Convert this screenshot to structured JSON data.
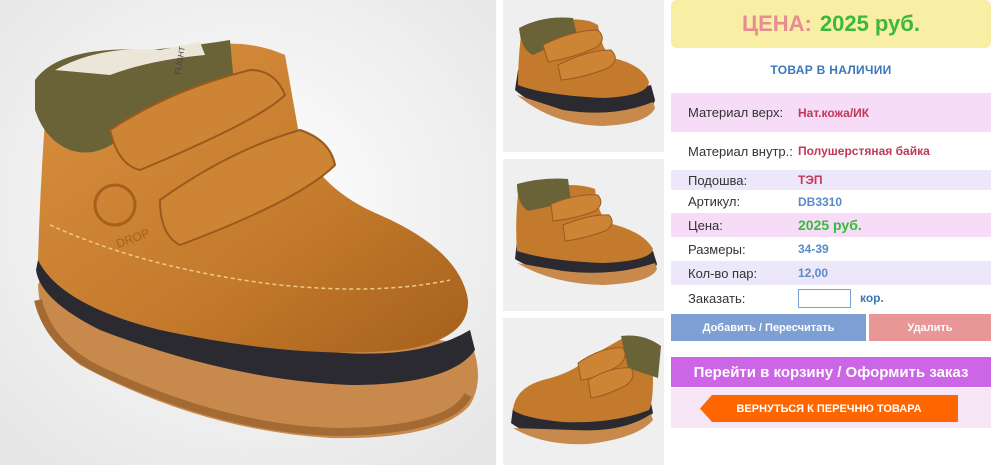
{
  "price_header": {
    "label": "ЦЕНА:",
    "value": "2025 руб."
  },
  "availability": "ТОВАР В НАЛИЧИИ",
  "specs": {
    "material_top": {
      "label": "Материал верх:",
      "value": "Нат.кожа/ИК"
    },
    "material_inner": {
      "label": "Материал внутр.:",
      "value": "Полушерстяная байка"
    },
    "sole": {
      "label": "Подошва:",
      "value": "ТЭП"
    },
    "article": {
      "label": "Артикул:",
      "value": "DB3310"
    },
    "price": {
      "label": "Цена:",
      "value": "2025 руб."
    },
    "sizes": {
      "label": "Размеры:",
      "value": "34-39"
    },
    "pairs": {
      "label": "Кол-во пар:",
      "value": "12,00"
    },
    "order": {
      "label": "Заказать:",
      "value": "",
      "unit": "кор."
    }
  },
  "buttons": {
    "add": "Добавить / Пересчитать",
    "delete": "Удалить",
    "cart": "Перейти в корзину / Оформить заказ",
    "back": "ВЕРНУТЬСЯ К ПЕРЕЧНЮ ТОВАРА"
  },
  "boot_logo": {
    "collar": "FLIGHT",
    "side": "DROP"
  },
  "colors": {
    "price_bg": "#f8efa4",
    "price_label": "#e88c94",
    "price_value": "#3cb83c",
    "row_pink": "#f6dcf6",
    "row_lavender": "#ece8fa",
    "add_button": "#7e9fd3",
    "delete_button": "#e89696",
    "cart_button": "#cc66e6",
    "back_button": "#ff6600"
  }
}
